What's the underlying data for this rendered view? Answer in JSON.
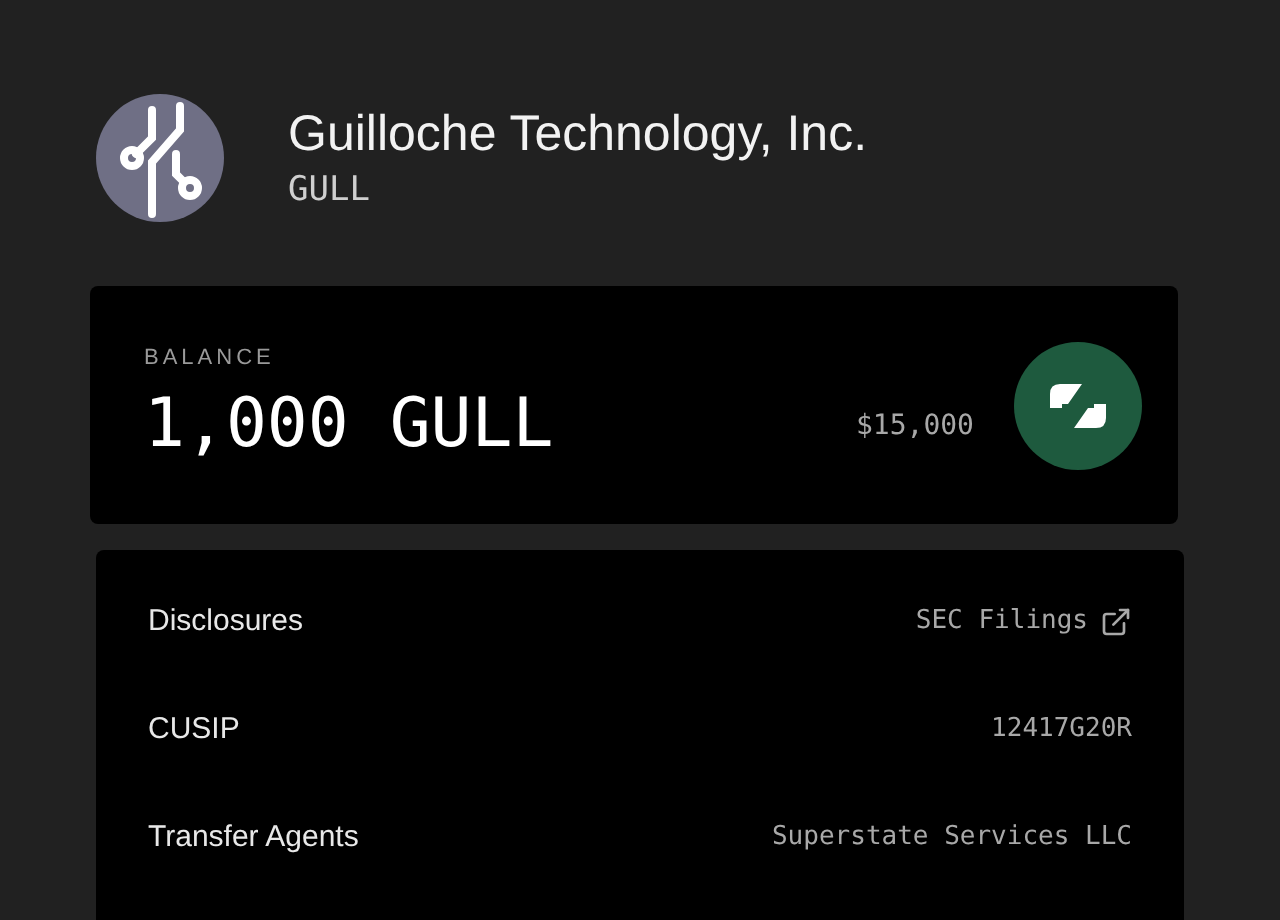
{
  "company": {
    "name": "Guilloche Technology, Inc.",
    "ticker": "GULL"
  },
  "balance": {
    "label": "BALANCE",
    "amount": "1,000 GULL",
    "value": "$15,000"
  },
  "details": [
    {
      "label": "Disclosures",
      "value": "SEC Filings",
      "kind": "link"
    },
    {
      "label": "CUSIP",
      "value": "12417G20R",
      "kind": "text"
    },
    {
      "label": "Transfer Agents",
      "value": "Superstate Services LLC",
      "kind": "text"
    }
  ]
}
